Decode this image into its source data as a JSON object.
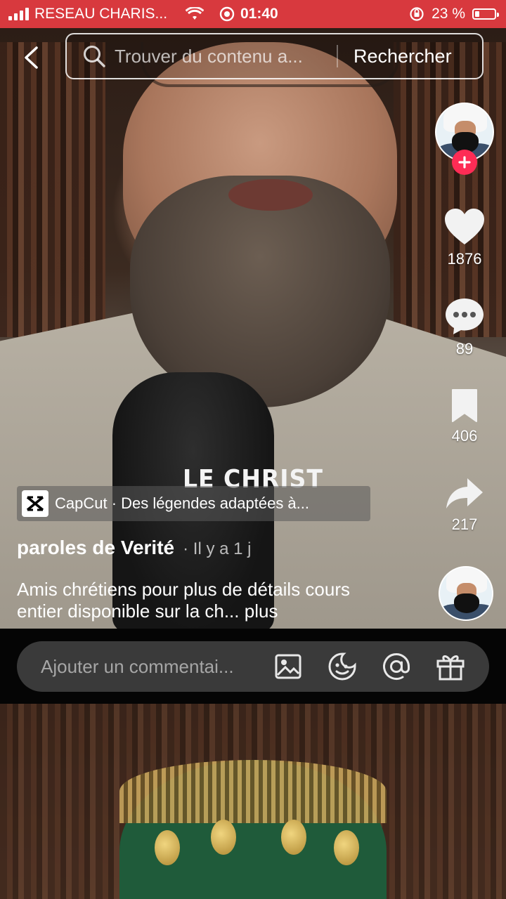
{
  "status_bar": {
    "carrier": "RESEAU CHARIS...",
    "time": "01:40",
    "battery": "23 %",
    "battery_level": 0.23
  },
  "search": {
    "placeholder": "Trouver du contenu a...",
    "submit_label": "Rechercher"
  },
  "actions": {
    "likes": "1876",
    "comments": "89",
    "saves": "406",
    "shares": "217"
  },
  "video": {
    "overlay_text": "LE CHRIST",
    "capcut_banner": "CapCut · Des légendes adaptées à...",
    "author": "paroles de Verité",
    "time_ago": "· Il y a 1 j",
    "caption": "Amis chrétiens pour plus de détails cours entier disponible sur la ch...",
    "more_label": "plus"
  },
  "comment": {
    "placeholder": "Ajouter un commentai..."
  },
  "colors": {
    "status_bar": "#d8393e",
    "follow_plus": "#fe2c55",
    "comment_bar": "#3a3a3a"
  },
  "icons": [
    "back-icon",
    "search-icon",
    "heart-icon",
    "comment-icon",
    "bookmark-icon",
    "share-icon",
    "image-icon",
    "emoji-icon",
    "mention-icon",
    "gift-icon",
    "capcut-icon",
    "wifi-icon",
    "alarm-icon",
    "lock-rotation-icon"
  ]
}
